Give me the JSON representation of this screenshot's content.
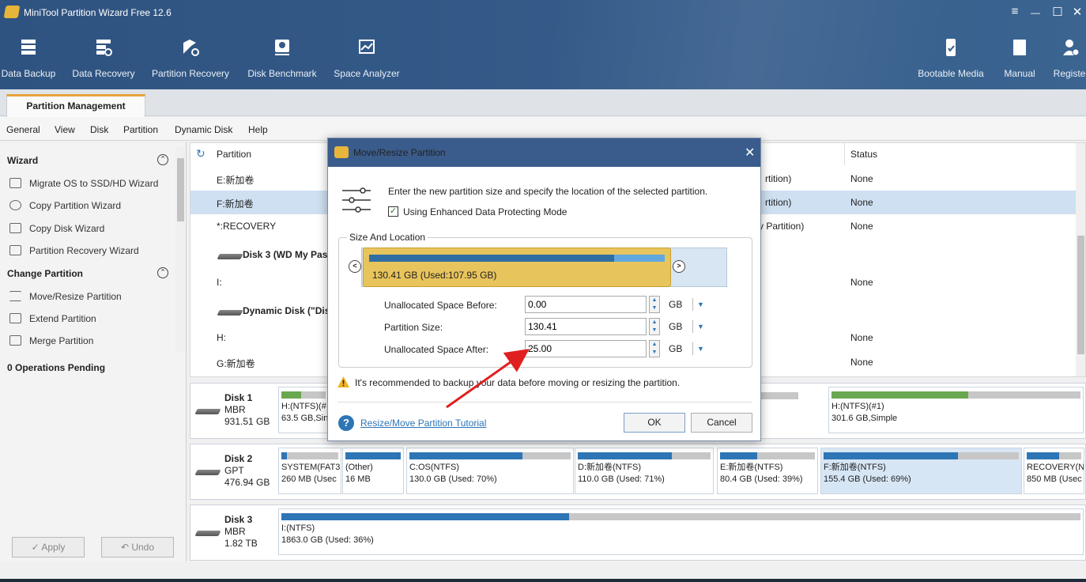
{
  "app": {
    "title": "MiniTool Partition Wizard Free 12.6"
  },
  "toolbar": {
    "items": [
      "Data Backup",
      "Data Recovery",
      "Partition Recovery",
      "Disk Benchmark",
      "Space Analyzer"
    ],
    "right_items": [
      "Bootable Media",
      "Manual",
      "Register"
    ]
  },
  "window_controls": {
    "menu": "≡",
    "minimize": "—",
    "maximize": "☐",
    "close": "✕"
  },
  "tabs": {
    "active": "Partition Management"
  },
  "menu": [
    "General",
    "View",
    "Disk",
    "Partition",
    "Dynamic Disk",
    "Help"
  ],
  "sidebar": {
    "wizard_title": "Wizard",
    "wizard_items": [
      "Migrate OS to SSD/HD Wizard",
      "Copy Partition Wizard",
      "Copy Disk Wizard",
      "Partition Recovery Wizard"
    ],
    "change_title": "Change Partition",
    "change_items": [
      "Move/Resize Partition",
      "Extend Partition",
      "Merge Partition"
    ],
    "pending": "0 Operations Pending",
    "apply": "✓ Apply",
    "undo": "↶ Undo"
  },
  "table": {
    "col_partition": "Partition",
    "col_status": "Status",
    "rows": [
      {
        "name": "E:新加卷",
        "type": "rtition)",
        "status": "None"
      },
      {
        "name": "F:新加卷",
        "type": "rtition)",
        "status": "None"
      },
      {
        "name": "*:RECOVERY",
        "type": "y Partition)",
        "status": "None"
      },
      {
        "name": "Disk 3 (WD My Pass",
        "type": "",
        "status": ""
      },
      {
        "name": "I:",
        "type": "",
        "status": "None"
      },
      {
        "name": "Dynamic Disk (\"Disk",
        "type": "",
        "status": ""
      },
      {
        "name": "H:",
        "type": "",
        "status": "None"
      },
      {
        "name": "G:新加卷",
        "type": "",
        "status": "None"
      }
    ]
  },
  "disks": [
    {
      "name": "Disk 1",
      "style": "MBR",
      "size": "931.51 GB",
      "parts": [
        {
          "label": "H:(NTFS)(#",
          "info": "63.5 GB,Sin",
          "used": 0.45
        },
        {
          "label": "H:(NTFS)(#1)",
          "info": "301.6 GB,Simple",
          "used": 0.55
        }
      ]
    },
    {
      "name": "Disk 2",
      "style": "GPT",
      "size": "476.94 GB",
      "parts": [
        {
          "label": "SYSTEM(FAT3",
          "info": "260 MB (Usec",
          "used": 0.1
        },
        {
          "label": "(Other)",
          "info": "16 MB",
          "used": 1.0
        },
        {
          "label": "C:OS(NTFS)",
          "info": "130.0 GB (Used: 70%)",
          "used": 0.7
        },
        {
          "label": "D:新加卷(NTFS)",
          "info": "110.0 GB (Used: 71%)",
          "used": 0.71
        },
        {
          "label": "E:新加卷(NTFS)",
          "info": "80.4 GB (Used: 39%)",
          "used": 0.39
        },
        {
          "label": "F:新加卷(NTFS)",
          "info": "155.4 GB (Used: 69%)",
          "used": 0.69
        },
        {
          "label": "RECOVERY(N",
          "info": "850 MB (Usec",
          "used": 0.6
        }
      ]
    },
    {
      "name": "Disk 3",
      "style": "MBR",
      "size": "1.82 TB",
      "parts": [
        {
          "label": "I:(NTFS)",
          "info": "1863.0 GB (Used: 36%)",
          "used": 0.36
        }
      ]
    }
  ],
  "dialog": {
    "title": "Move/Resize Partition",
    "intro": "Enter the new partition size and specify the location of the selected partition.",
    "enhanced_mode": "Using Enhanced Data Protecting Mode",
    "group_title": "Size And Location",
    "partition_caption": "130.41 GB (Used:107.95 GB)",
    "partition_used_fraction": 0.83,
    "fields": [
      {
        "label": "Unallocated Space Before:",
        "value": "0.00",
        "unit": "GB"
      },
      {
        "label": "Partition Size:",
        "value": "130.41",
        "unit": "GB"
      },
      {
        "label": "Unallocated Space After:",
        "value": "25.00",
        "unit": "GB"
      }
    ],
    "warning": "It's recommended to backup your data before moving or resizing the partition.",
    "tutorial_link": "Resize/Move Partition Tutorial",
    "ok": "OK",
    "cancel": "Cancel"
  },
  "colors": {
    "accent": "#2e75b6",
    "title_bar": "#3a5c8c",
    "partition_handle": "#e8c45c",
    "arrow": "#e02020"
  }
}
